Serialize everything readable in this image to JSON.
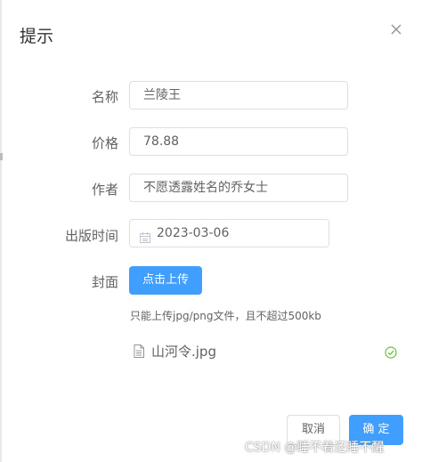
{
  "dialog": {
    "title": "提示",
    "close_icon": "close-icon"
  },
  "form": {
    "name_label": "名称",
    "name_value": "兰陵王",
    "price_label": "价格",
    "price_value": "78.88",
    "author_label": "作者",
    "author_value": "不愿透露姓名的乔女士",
    "date_label": "出版时间",
    "date_value": "2023-03-06",
    "cover_label": "封面",
    "upload_button": "点击上传",
    "upload_tip": "只能上传jpg/png文件，且不超过500kb",
    "uploaded_file": "山河令.jpg",
    "file_icon": "document-icon",
    "status_icon": "success-check-icon"
  },
  "footer": {
    "cancel_label": "取消",
    "confirm_label": "确 定"
  },
  "watermark": "CSDN @睡不着还睡不醒",
  "colors": {
    "primary": "#409eff",
    "success": "#67c23a",
    "border": "#dcdfe6",
    "text": "#606266"
  }
}
